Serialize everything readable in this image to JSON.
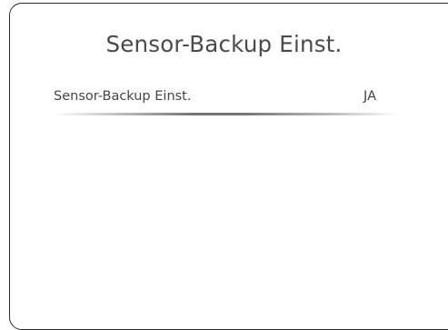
{
  "header": {
    "title": "Sensor-Backup Einst."
  },
  "settings": {
    "rows": [
      {
        "label": "Sensor-Backup Einst.",
        "value": "JA"
      }
    ]
  },
  "colors": {
    "text": "#444444",
    "title_text": "#4a4a4a",
    "frame_border": "#2b2b2b",
    "background": "#ffffff"
  }
}
